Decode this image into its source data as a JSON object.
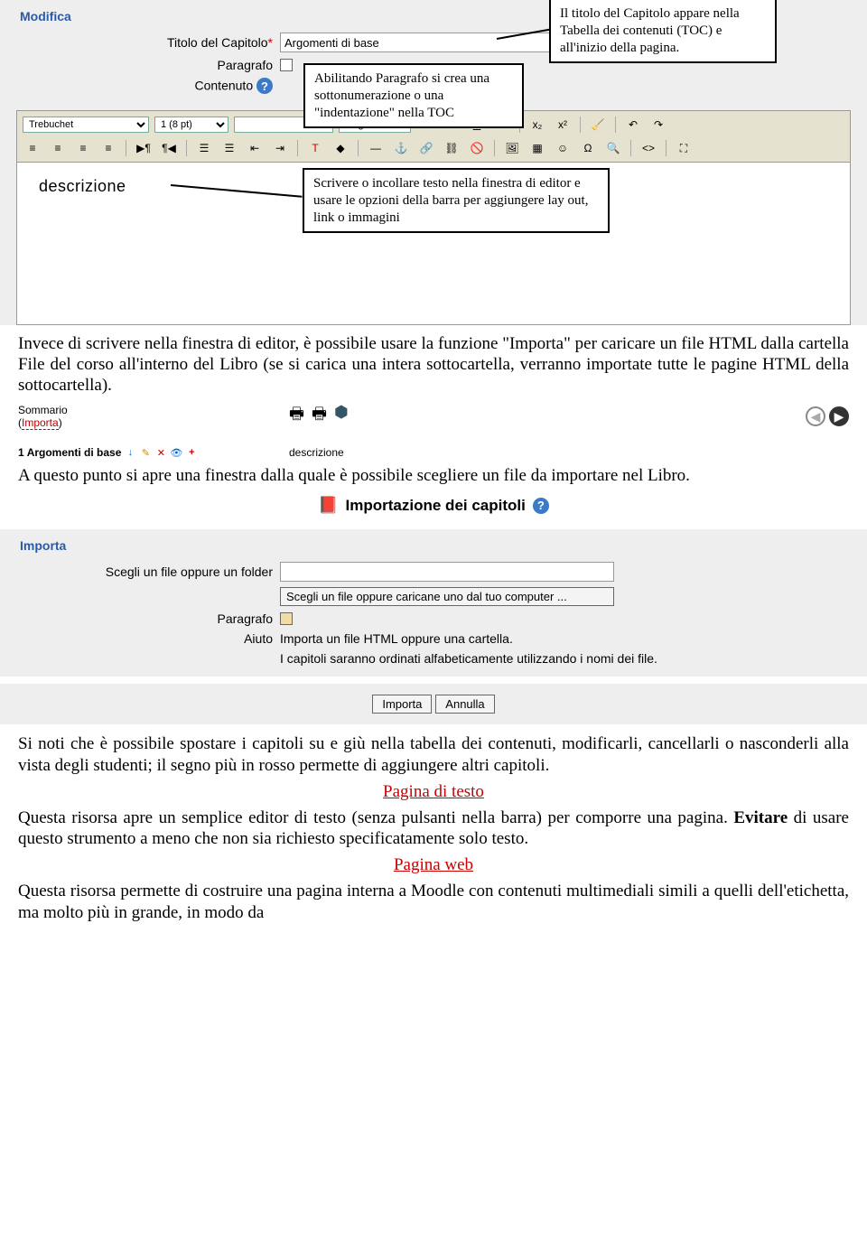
{
  "modifica": {
    "header": "Modifica",
    "titolo_label": "Titolo del Capitolo",
    "titolo_value": "Argomenti di base",
    "paragrafo_label": "Paragrafo",
    "contenuto_label": "Contenuto"
  },
  "callouts": {
    "c1": "Il titolo del Capitolo appare nella Tabella dei contenuti (TOC) e all'inizio della pagina.",
    "c2": "Abilitando Paragrafo si crea una sottonumerazione o una \"indentazione\" nella TOC",
    "c3": "Scrivere o incollare testo nella finestra di editor e usare le opzioni della barra per aggiungere lay out, link o immagini"
  },
  "toolbar": {
    "font": "Trebuchet",
    "size": "1 (8 pt)",
    "empty": "",
    "lang": "Lingua"
  },
  "editor": {
    "content": "descrizione"
  },
  "body1": "Invece di scrivere nella finestra di editor, è possibile usare la funzione \"Importa\" per caricare un file HTML dalla cartella File del corso all'interno del Libro (se si carica una intera sottocartella, verranno importate tutte le pagine HTML della sottocartella).",
  "summary": {
    "label": "Sommario",
    "importa": "Importa",
    "item_num": "1",
    "item_title": "Argomenti di base",
    "desc": "descrizione"
  },
  "body2": "A questo punto si apre una finestra dalla quale è possibile scegliere un file da importare nel Libro.",
  "import_section": {
    "title": "Importazione dei capitoli",
    "header": "Importa",
    "file_label": "Scegli un file oppure un folder",
    "file_button": "Scegli un file oppure caricane uno dal tuo computer ...",
    "paragrafo_label": "Paragrafo",
    "aiuto_label": "Aiuto",
    "aiuto_text1": "Importa un file HTML oppure una cartella.",
    "aiuto_text2": "I capitoli saranno ordinati alfabeticamente utilizzando i nomi dei file.",
    "btn_importa": "Importa",
    "btn_annulla": "Annulla"
  },
  "body3": "Si noti che è possibile spostare i capitoli su e giù nella tabella dei contenuti, modificarli, cancellarli o nasconderli alla vista degli studenti; il segno più in rosso permette di aggiungere altri capitoli.",
  "heading_pagina_testo": "Pagina di testo",
  "body4a": "Questa risorsa apre un semplice editor di testo (senza pulsanti nella barra) per comporre una pagina. ",
  "body4b": "Evitare",
  "body4c": " di usare questo strumento a meno che non sia richiesto specificatamente solo testo.",
  "heading_pagina_web": "Pagina web",
  "body5": "Questa risorsa permette di costruire una pagina interna a Moodle con contenuti multimediali simili a quelli dell'etichetta, ma molto più in grande, in modo da"
}
